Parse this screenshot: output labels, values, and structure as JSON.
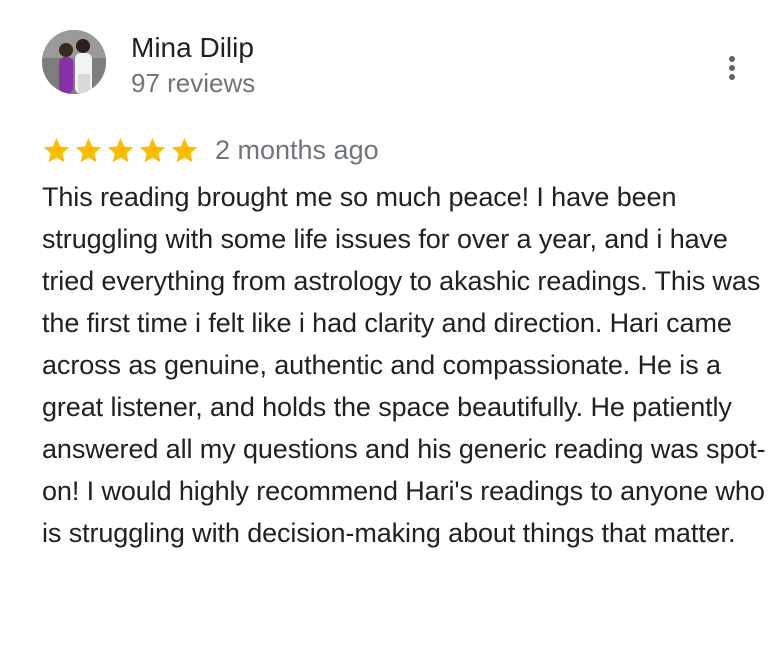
{
  "reviewer": {
    "name": "Mina Dilip",
    "review_count": "97 reviews",
    "avatar_icon": "reviewer-photo"
  },
  "menu": {
    "icon": "more-vertical-icon"
  },
  "rating": {
    "stars": 5,
    "max_stars": 5,
    "star_color": "#fbbc04",
    "date": "2 months ago"
  },
  "review": {
    "text": "This reading brought me so much peace! I have been struggling with some life issues for over a year, and i have tried everything from astrology to akashic readings. This was the first time i felt like i had clarity and direction. Hari came across as genuine, authentic and compassionate. He is a great listener, and holds the space beautifully. He patiently answered all my questions and his generic reading was spot-on! I would highly recommend Hari's readings to anyone who is struggling with decision-making about things that matter."
  },
  "colors": {
    "primary_text": "#202124",
    "secondary_text": "#70757a",
    "star": "#fbbc04"
  }
}
